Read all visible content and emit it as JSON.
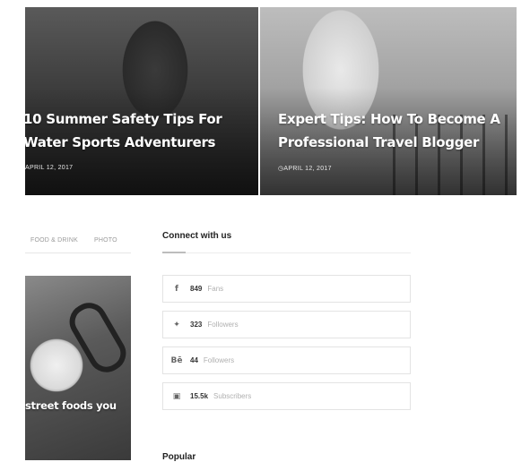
{
  "hero": [
    {
      "title": "10 Summer Safety Tips For Water Sports Adventurers",
      "date": "APRIL 12, 2017"
    },
    {
      "title": "Expert Tips: How To Become A Professional Travel Blogger",
      "date": "APRIL 12, 2017"
    }
  ],
  "categories": [
    "FOOD & DRINK",
    "PHOTO"
  ],
  "food_card": {
    "title": "street foods you"
  },
  "connect": {
    "title": "Connect with us",
    "items": [
      {
        "icon": "facebook-icon",
        "glyph": "f",
        "count": "849",
        "label": "Fans"
      },
      {
        "icon": "twitter-icon",
        "glyph": "🐦",
        "count": "323",
        "label": "Followers"
      },
      {
        "icon": "behance-icon",
        "glyph": "Bē",
        "count": "44",
        "label": "Followers"
      },
      {
        "icon": "youtube-icon",
        "glyph": "▶",
        "count": "15.5k",
        "label": "Subscribers"
      }
    ]
  },
  "popular": {
    "title": "Popular"
  }
}
